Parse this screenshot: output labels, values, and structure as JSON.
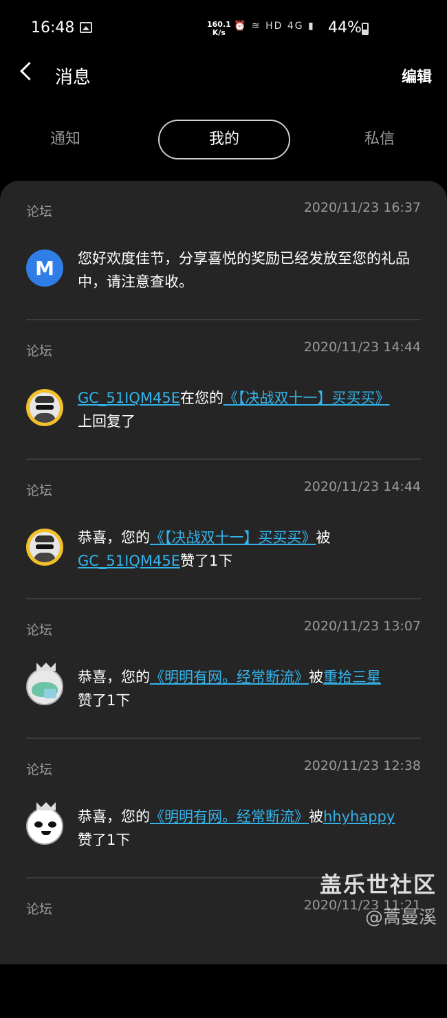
{
  "status": {
    "time": "16:48",
    "speed_value": "160.1",
    "speed_unit": "K/s",
    "network": "HD 4G",
    "battery": "44%"
  },
  "header": {
    "title": "消息",
    "edit_label": "编辑"
  },
  "tabs": [
    "通知",
    "我的",
    "私信"
  ],
  "items": [
    {
      "source": "论坛",
      "time": "2020/11/23 16:37",
      "avatar_icon": "meizu-m-icon",
      "text": "您好欢度佳节，分享喜悦的奖励已经发放至您的礼品中，请注意查收。"
    },
    {
      "source": "论坛",
      "time": "2020/11/23 14:44",
      "user": "GC_51IQM45E",
      "text_a": "在您的",
      "link": "《【决战双十一】买买买》",
      "text_b": "上回复了"
    },
    {
      "source": "论坛",
      "time": "2020/11/23 14:44",
      "prefix": "恭喜，您的",
      "link": "《【决战双十一】买买买》",
      "mid": "被",
      "user": "GC_51IQM45E",
      "suffix": "赞了1下"
    },
    {
      "source": "论坛",
      "time": "2020/11/23 13:07",
      "prefix": "恭喜，您的",
      "link": "《明明有网。经常断流》",
      "mid": "被",
      "user": "重拾三星",
      "suffix": "赞了1下"
    },
    {
      "source": "论坛",
      "time": "2020/11/23 12:38",
      "prefix": "恭喜，您的",
      "link": "《明明有网。经常断流》",
      "mid": "被",
      "user": "hhyhappy",
      "suffix": "赞了1下"
    },
    {
      "source": "论坛",
      "time": "2020/11/23 11:21"
    }
  ],
  "watermark": {
    "line1": "盖乐世社区",
    "line2": "@蒿曼溪"
  },
  "colors": {
    "link": "#34b3ea",
    "panel": "#252525",
    "background": "#000000"
  }
}
